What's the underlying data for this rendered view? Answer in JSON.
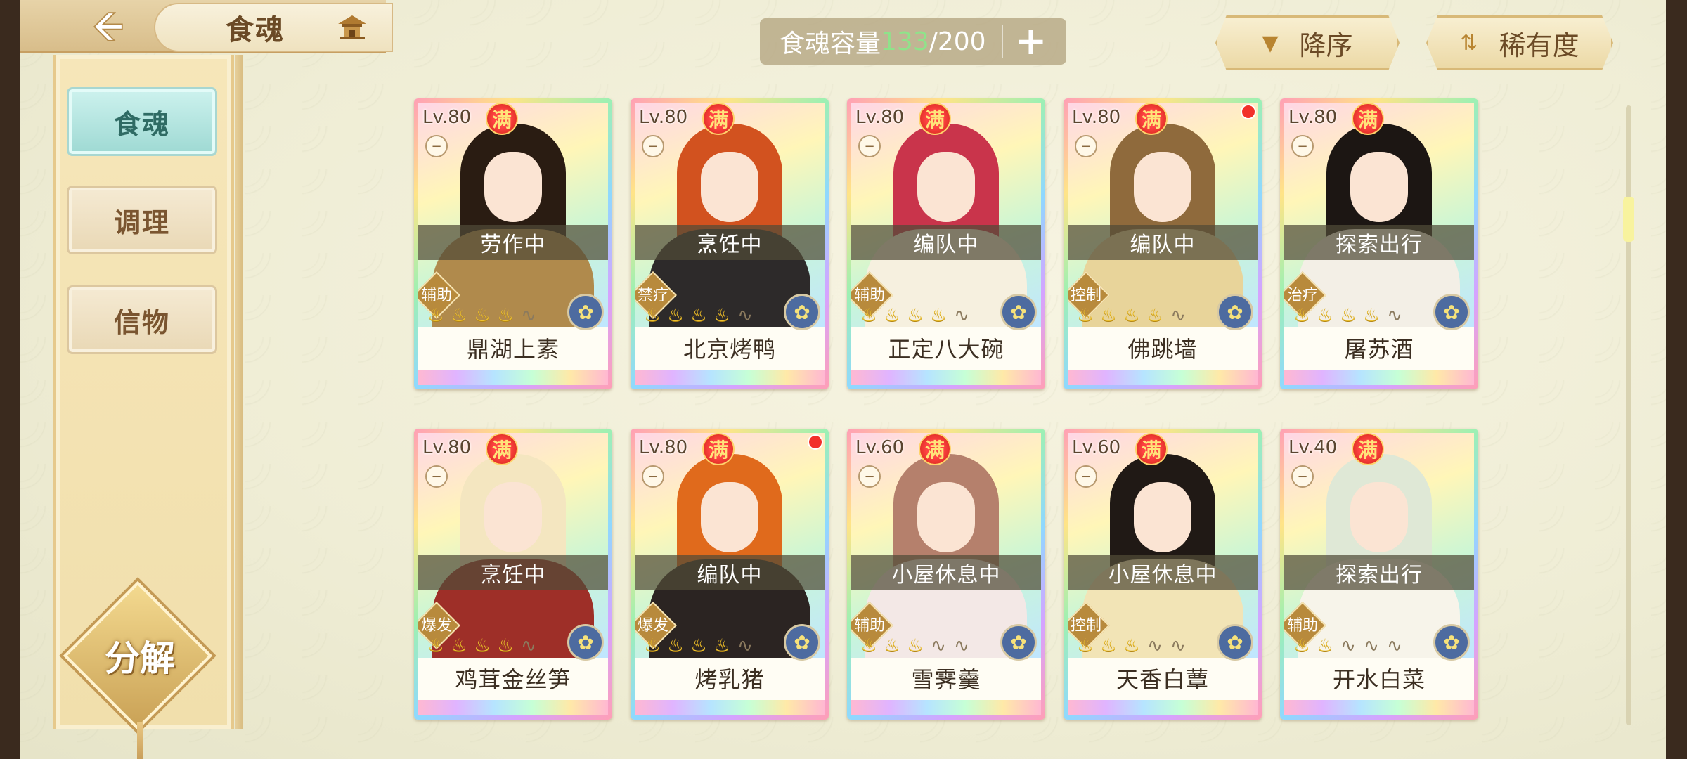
{
  "header": {
    "title": "食魂",
    "capacity": {
      "label": "食魂容量",
      "current": "133",
      "max": "/200"
    },
    "sort_order_label": "降序",
    "sort_key_label": "稀有度"
  },
  "sidebar": {
    "tabs": [
      {
        "label": "食魂",
        "active": true
      },
      {
        "label": "调理",
        "active": false
      },
      {
        "label": "信物",
        "active": false
      }
    ],
    "decompose_label": "分解"
  },
  "colors": {
    "full_badge": "#e8342a",
    "status_bar": "#504b37",
    "capacity_current": "#8fe38a"
  },
  "cards": [
    {
      "level": "Lv.80",
      "full": "满",
      "status": "劳作中",
      "role": "辅助",
      "stars": 4,
      "name": "鼎湖上素",
      "hair": "#2a1c12",
      "robe": "#b08a4c",
      "dot": false
    },
    {
      "level": "Lv.80",
      "full": "满",
      "status": "烹饪中",
      "role": "禁疗",
      "stars": 4,
      "name": "北京烤鸭",
      "hair": "#d2521f",
      "robe": "#2d2a2a",
      "dot": false
    },
    {
      "level": "Lv.80",
      "full": "满",
      "status": "编队中",
      "role": "辅助",
      "stars": 4,
      "name": "正定八大碗",
      "hair": "#c9344b",
      "robe": "#f6f0df",
      "dot": false
    },
    {
      "level": "Lv.80",
      "full": "满",
      "status": "编队中",
      "role": "控制",
      "stars": 4,
      "name": "佛跳墙",
      "hair": "#8f6a3c",
      "robe": "#e8d49a",
      "dot": true
    },
    {
      "level": "Lv.80",
      "full": "满",
      "status": "探索出行",
      "role": "治疗",
      "stars": 4,
      "name": "屠苏酒",
      "hair": "#1c1613",
      "robe": "#f3efe6",
      "dot": false
    },
    {
      "level": "Lv.80",
      "full": "满",
      "status": "烹饪中",
      "role": "爆发",
      "stars": 4,
      "name": "鸡茸金丝笋",
      "hair": "#f4e6c0",
      "robe": "#9e2f28",
      "dot": false
    },
    {
      "level": "Lv.80",
      "full": "满",
      "status": "编队中",
      "role": "爆发",
      "stars": 4,
      "name": "烤乳猪",
      "hair": "#e06a1c",
      "robe": "#2b2422",
      "dot": true
    },
    {
      "level": "Lv.60",
      "full": "满",
      "status": "小屋休息中",
      "role": "辅助",
      "stars": 3,
      "name": "雪霁羹",
      "hair": "#b5806c",
      "robe": "#f3e8e6",
      "dot": false
    },
    {
      "level": "Lv.60",
      "full": "满",
      "status": "小屋休息中",
      "role": "控制",
      "stars": 3,
      "name": "天香白蕈",
      "hair": "#201915",
      "robe": "#f2e4b6",
      "dot": false
    },
    {
      "level": "Lv.40",
      "full": "满",
      "status": "探索出行",
      "role": "辅助",
      "stars": 2,
      "name": "开水白菜",
      "hair": "#dfe8d6",
      "robe": "#f7f4ea",
      "dot": false
    }
  ]
}
